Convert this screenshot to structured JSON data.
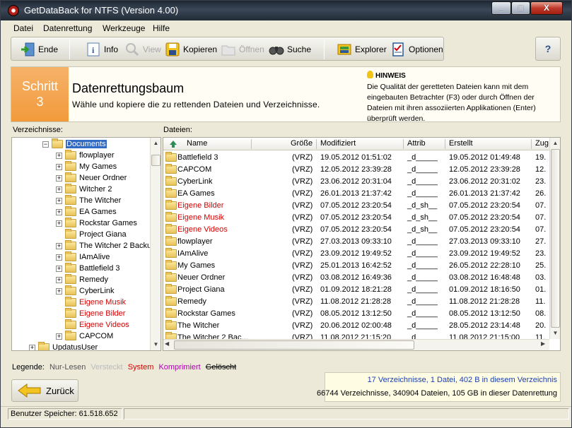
{
  "window": {
    "title": "GetDataBack for NTFS (Version 4.00)",
    "min_label": "_",
    "max_label": "□",
    "close_label": "X"
  },
  "menu": [
    "Datei",
    "Datenrettung",
    "Werkzeuge",
    "Hilfe"
  ],
  "toolbar": {
    "ende": "Ende",
    "info": "Info",
    "view": "View",
    "kopieren": "Kopieren",
    "oeffnen": "Öffnen",
    "suche": "Suche",
    "explorer": "Explorer",
    "optionen": "Optionen"
  },
  "help_label": "?",
  "header": {
    "step_word": "Schritt",
    "step_number": "3",
    "title": "Datenrettungsbaum",
    "subtitle": "Wähle und kopiere die zu rettenden Dateien und Verzeichnisse.",
    "hint_title": "HINWEIS",
    "hint_text": "Die Qualität der geretteten Dateien kann mit dem eingebauten Betrachter (F3) oder durch Öffnen der Dateien mit ihren assoziierten Applikationen (Enter) überprüft werden."
  },
  "labels": {
    "verzeichnisse": "Verzeichnisse:",
    "dateien": "Dateien:"
  },
  "tree": {
    "selected": "Documents",
    "children": [
      {
        "name": "flowplayer",
        "red": false,
        "expandable": true
      },
      {
        "name": "My Games",
        "red": false,
        "expandable": true
      },
      {
        "name": "Neuer Ordner",
        "red": false,
        "expandable": true
      },
      {
        "name": "Witcher 2",
        "red": false,
        "expandable": true
      },
      {
        "name": "The Witcher",
        "red": false,
        "expandable": true
      },
      {
        "name": "EA Games",
        "red": false,
        "expandable": true
      },
      {
        "name": "Rockstar Games",
        "red": false,
        "expandable": true
      },
      {
        "name": "Project Giana",
        "red": false,
        "expandable": false
      },
      {
        "name": "The Witcher 2 Backu",
        "red": false,
        "expandable": true
      },
      {
        "name": "IAmAlive",
        "red": false,
        "expandable": true
      },
      {
        "name": "Battlefield 3",
        "red": false,
        "expandable": true
      },
      {
        "name": "Remedy",
        "red": false,
        "expandable": true
      },
      {
        "name": "CyberLink",
        "red": false,
        "expandable": true
      },
      {
        "name": "Eigene Musik",
        "red": true,
        "expandable": false
      },
      {
        "name": "Eigene Bilder",
        "red": true,
        "expandable": false
      },
      {
        "name": "Eigene Videos",
        "red": true,
        "expandable": false
      },
      {
        "name": "CAPCOM",
        "red": false,
        "expandable": true
      }
    ],
    "sibling": "UpdatusUser"
  },
  "files": {
    "columns": [
      "Name",
      "Größe",
      "Modifiziert",
      "Attrib",
      "Erstellt",
      "Zug"
    ],
    "rows": [
      {
        "name": "Battlefield 3",
        "size": "(VRZ)",
        "mod": "19.05.2012 01:51:02",
        "attr": "_d_____",
        "created": "19.05.2012 01:49:48",
        "acc": "19.",
        "red": false
      },
      {
        "name": "CAPCOM",
        "size": "(VRZ)",
        "mod": "12.05.2012 23:39:28",
        "attr": "_d_____",
        "created": "12.05.2012 23:39:28",
        "acc": "12.",
        "red": false
      },
      {
        "name": "CyberLink",
        "size": "(VRZ)",
        "mod": "23.06.2012 20:31:04",
        "attr": "_d_____",
        "created": "23.06.2012 20:31:02",
        "acc": "23.",
        "red": false
      },
      {
        "name": "EA Games",
        "size": "(VRZ)",
        "mod": "26.01.2013 21:37:42",
        "attr": "_d_____",
        "created": "26.01.2013 21:37:42",
        "acc": "26.",
        "red": false
      },
      {
        "name": "Eigene Bilder",
        "size": "(VRZ)",
        "mod": "07.05.2012 23:20:54",
        "attr": "_d_sh__",
        "created": "07.05.2012 23:20:54",
        "acc": "07.",
        "red": true
      },
      {
        "name": "Eigene Musik",
        "size": "(VRZ)",
        "mod": "07.05.2012 23:20:54",
        "attr": "_d_sh__",
        "created": "07.05.2012 23:20:54",
        "acc": "07.",
        "red": true
      },
      {
        "name": "Eigene Videos",
        "size": "(VRZ)",
        "mod": "07.05.2012 23:20:54",
        "attr": "_d_sh__",
        "created": "07.05.2012 23:20:54",
        "acc": "07.",
        "red": true
      },
      {
        "name": "flowplayer",
        "size": "(VRZ)",
        "mod": "27.03.2013 09:33:10",
        "attr": "_d_____",
        "created": "27.03.2013 09:33:10",
        "acc": "27.",
        "red": false
      },
      {
        "name": "IAmAlive",
        "size": "(VRZ)",
        "mod": "23.09.2012 19:49:52",
        "attr": "_d_____",
        "created": "23.09.2012 19:49:52",
        "acc": "23.",
        "red": false
      },
      {
        "name": "My Games",
        "size": "(VRZ)",
        "mod": "25.01.2013 16:42:52",
        "attr": "_d_____",
        "created": "26.05.2012 22:28:10",
        "acc": "25.",
        "red": false
      },
      {
        "name": "Neuer Ordner",
        "size": "(VRZ)",
        "mod": "03.08.2012 16:49:36",
        "attr": "_d_____",
        "created": "03.08.2012 16:48:48",
        "acc": "03.",
        "red": false
      },
      {
        "name": "Project Giana",
        "size": "(VRZ)",
        "mod": "01.09.2012 18:21:28",
        "attr": "_d_____",
        "created": "01.09.2012 18:16:50",
        "acc": "01.",
        "red": false
      },
      {
        "name": "Remedy",
        "size": "(VRZ)",
        "mod": "11.08.2012 21:28:28",
        "attr": "_d_____",
        "created": "11.08.2012 21:28:28",
        "acc": "11.",
        "red": false
      },
      {
        "name": "Rockstar Games",
        "size": "(VRZ)",
        "mod": "08.05.2012 13:12:50",
        "attr": "_d_____",
        "created": "08.05.2012 13:12:50",
        "acc": "08.",
        "red": false
      },
      {
        "name": "The Witcher",
        "size": "(VRZ)",
        "mod": "20.06.2012 02:00:48",
        "attr": "_d_____",
        "created": "28.05.2012 23:14:48",
        "acc": "20.",
        "red": false
      },
      {
        "name": "The Witcher 2 Bac...",
        "size": "(VRZ)",
        "mod": "11.08.2012 21:15:20",
        "attr": "_d_____",
        "created": "11.08.2012 21:15:00",
        "acc": "11.",
        "red": false
      }
    ]
  },
  "legend": {
    "label": "Legende:",
    "nur_lesen": "Nur-Lesen",
    "versteckt": "Versteckt",
    "system": "System",
    "komprimiert": "Komprimiert",
    "geloescht": "Gelöscht"
  },
  "summary": {
    "line1": "17 Verzeichnisse, 1 Datei, 402 B in diesem Verzeichnis",
    "line2": "66744 Verzeichnisse, 340904 Dateien, 105 GB in dieser Datenrettung"
  },
  "back_button": "Zurück",
  "statusbar": {
    "memory": "Benutzer Speicher: 61.518.652"
  },
  "colors": {
    "step_orange": "#f29a3b",
    "selection": "#316ac5",
    "red_text": "#d40000",
    "summary_blue": "#1a3fb0",
    "compressed": "#b000b0"
  }
}
